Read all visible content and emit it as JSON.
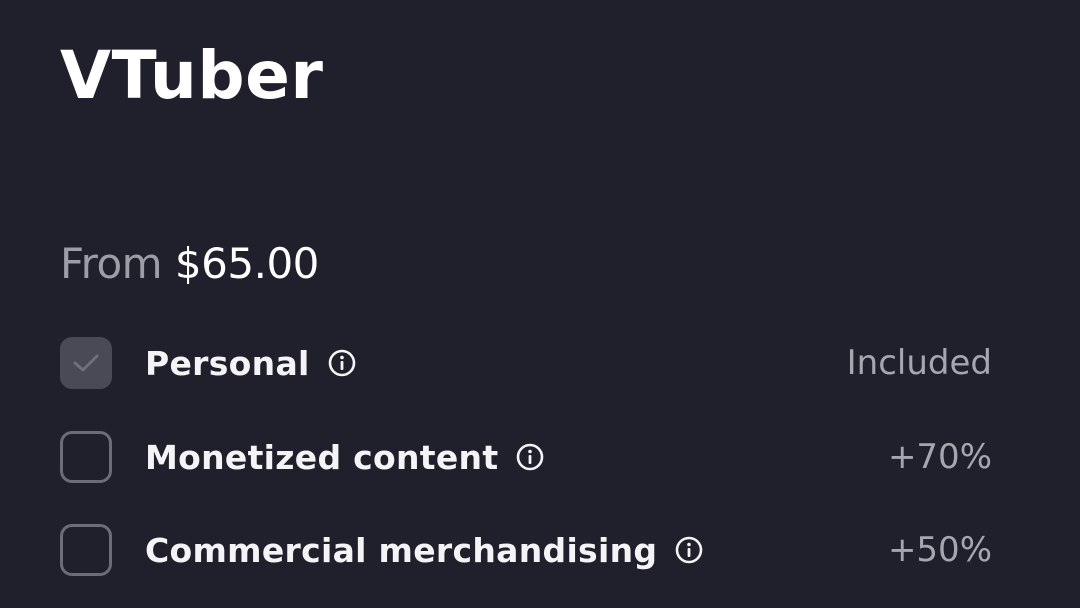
{
  "product": {
    "title": "VTuber"
  },
  "pricing": {
    "prefix": "From",
    "amount": "$65.00"
  },
  "license_options": [
    {
      "label": "Personal",
      "value": "Included",
      "checked": true,
      "icon": "info-icon"
    },
    {
      "label": "Monetized content",
      "value": "+70%",
      "checked": false,
      "icon": "info-icon"
    },
    {
      "label": "Commercial merchandising",
      "value": "+50%",
      "checked": false,
      "icon": "info-icon"
    }
  ],
  "colors": {
    "background": "#20202d",
    "text": "#ffffff",
    "muted": "#9d9da6",
    "checkbox_border": "#6c6c78",
    "checkbox_checked": "#4a4a57"
  }
}
